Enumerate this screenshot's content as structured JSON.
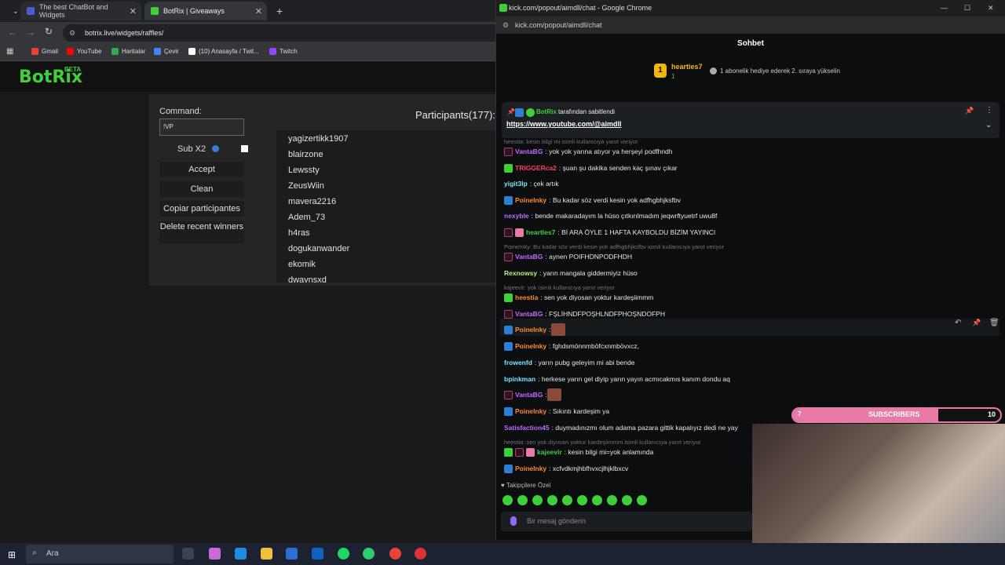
{
  "tabs": [
    {
      "title": "The best ChatBot and Widgets"
    },
    {
      "title": "BotRix | Giveaways"
    }
  ],
  "address": "botrix.live/widgets/raffles/",
  "bookmarks": [
    "Gmail",
    "YouTube",
    "Haritalar",
    "Çevir",
    "(10) Anasayfa / Twit...",
    "Twitch"
  ],
  "botrix": {
    "logo": "BotRix",
    "beta": "BETA",
    "command_label": "Command:",
    "command_value": "!VP",
    "subx2_label": "Sub X2",
    "accept": "Accept",
    "clean": "Clean",
    "copy": "Copiar participantes",
    "delete_recent": "Delete recent winners",
    "participants_label": "Participants(177):",
    "participants": [
      "yagizertikk1907",
      "blairzone",
      "Lewssty",
      "ZeusWiin",
      "mavera2216",
      "Adem_73",
      "h4ras",
      "dogukanwander",
      "ekomik",
      "dwaynsxd"
    ]
  },
  "popout": {
    "window_title": "kick.com/popout/aimdll/chat - Google Chrome",
    "url": "kick.com/popout/aimdll/chat",
    "header": "Sohbet",
    "top_user": "hearties7",
    "top_count": "1",
    "top_rank": "1",
    "gift_note": "1 abonelik hediye ederek 2. sıraya yükselin",
    "pinned_by": "BotRix",
    "pinned_suffix": "tarafından sabitlendi",
    "pinned_link": "https://www.youtube.com/@aimdll",
    "followers_only": "Takipçilere Özel",
    "input_placeholder": "Bir mesaj gönderin"
  },
  "chat": [
    {
      "reply": "heestia: kesin bilgi mi isimli kullanıcıya yanıt veriyor"
    },
    {
      "user": "VantaBG",
      "color": "#c06bff",
      "text": ": yok yok yarına atıyor ya herşeyi podfhndh"
    },
    {
      "user": "TRIGGERca2",
      "color": "#ff3b6b",
      "text": ": şuan şu dakika senden kaç şınav çıkar"
    },
    {
      "user": "yigit3lp",
      "color": "#7de3ff",
      "text": ": çek artık"
    },
    {
      "user": "PoineInky",
      "color": "#ff8c2e",
      "text": ": Bu kadar söz verdi kesin yok adfhgbhjksfbv"
    },
    {
      "user": "nexyble",
      "color": "#b86bff",
      "text": ": bende makaradayım la hüso çıtkırılmadım jeqwrftyuetrf uwu8f"
    },
    {
      "user": "heartles7",
      "color": "#3fcf3a",
      "text": ": Bİ ARA ÖYLE 1 HAFTA KAYBOLDU BİZİM YAYINCI"
    },
    {
      "reply": "PoineInky: Bu kadar söz verdi kesin yok adfhgbhjksfbv isimli kullanıcıya yanıt veriyor"
    },
    {
      "user": "VantaBG",
      "color": "#c06bff",
      "text": ": aynen POIFHDNPODFHDH"
    },
    {
      "user": "Rexnowsy",
      "color": "#b5f27a",
      "text": ": yarın mangala giddermiyiz hüso"
    },
    {
      "reply": "kajeevir: yok isimli kullanıcıya yanıt veriyor"
    },
    {
      "user": "heestia",
      "color": "#ff8c2e",
      "text": ": sen yok diyosan yoktur kardeşiimmm"
    },
    {
      "user": "VantaBG",
      "color": "#c06bff",
      "text": ": FŞLİHNDFPOŞHLNDFPHOŞNDOFPH"
    },
    {
      "user": "PoineInky",
      "color": "#ff8c2e",
      "text": ":"
    },
    {
      "user": "PoineInky",
      "color": "#ff8c2e",
      "text": ": fghdsmönnmböfcxnmbövxcz,"
    },
    {
      "user": "frowenfd",
      "color": "#7de3ff",
      "text": ": yarın pubg geleyim mi abi bende"
    },
    {
      "user": "bpinkman",
      "color": "#7de3ff",
      "text": ": herkese yarın gel diyip yarın yayın acmıcakmıs kanım dondu aq"
    },
    {
      "user": "VantaBG",
      "color": "#c06bff",
      "text": ":"
    },
    {
      "user": "PoineInky",
      "color": "#ff8c2e",
      "text": ": Sıkıntı kardeşim ya"
    },
    {
      "user": "Satisfaction45",
      "color": "#b86bff",
      "text": ": duymadınızmı olum adama pazara gittik kapalıyız dedi ne yay"
    },
    {
      "reply": "heestia: sen yok diyosan yoktur kardeşiimmm isimli kullanıcıya yanıt veriyor"
    },
    {
      "user": "kajeevir",
      "color": "#3fcf3a",
      "text": ": kesin bilgi mi=yok anlamında"
    },
    {
      "user": "PoineInky",
      "color": "#ff8c2e",
      "text": ": xcfvdkmjhbfhvxcjlhjklbxcv"
    }
  ],
  "overlay": {
    "sub_start": "7",
    "sub_label": "SUBSCRIBERS",
    "sub_goal": "10",
    "sub_progress": 0.7
  },
  "taskbar": {
    "search": "Ara"
  }
}
